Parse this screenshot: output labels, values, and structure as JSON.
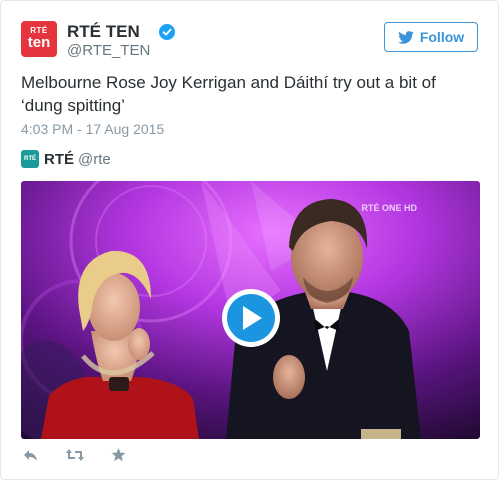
{
  "account": {
    "display_name": "RTÉ TEN",
    "handle": "@RTE_TEN",
    "avatar_line1": "RTÉ",
    "avatar_line2": "ten"
  },
  "follow_label": "Follow",
  "tweet": {
    "text": "Melbourne Rose Joy Kerrigan and Dáithí try out a bit of ‘dung spitting’",
    "timestamp": "4:03 PM - 17 Aug 2015"
  },
  "source": {
    "name": "RTÉ",
    "handle": "@rte",
    "avatar_text": "RTÉ"
  },
  "video": {
    "watermark": "RTÉ ONE HD"
  },
  "actions": [
    "reply-icon",
    "retweet-icon",
    "favorite-icon"
  ],
  "colors": {
    "brand_red": "#e6343f",
    "twitter_blue": "#3b94d9",
    "play_blue": "#1b95e0"
  }
}
